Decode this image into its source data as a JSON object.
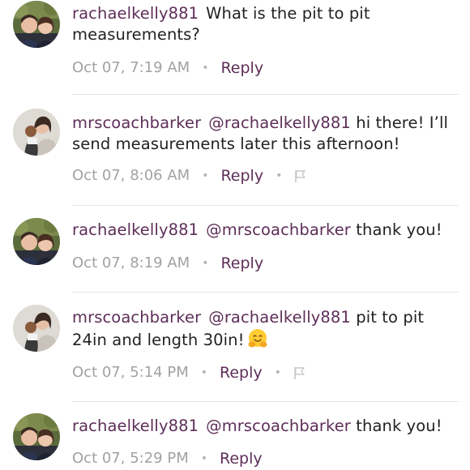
{
  "comments": [
    {
      "username": "rachaelkelly881",
      "mention": "",
      "body": "What is the pit to pit measurements?",
      "timestamp": "Oct 07, 7:19 AM",
      "reply_label": "Reply",
      "avatar_icon": "rachael-avatar",
      "has_flag": false
    },
    {
      "username": "mrscoachbarker",
      "mention": "@rachaelkelly881",
      "body": "hi there! I’ll send measurements later this afternoon!",
      "timestamp": "Oct 07, 8:06 AM",
      "reply_label": "Reply",
      "avatar_icon": "barker-avatar",
      "has_flag": true
    },
    {
      "username": "rachaelkelly881",
      "mention": "@mrscoachbarker",
      "body": "thank you!",
      "timestamp": "Oct 07, 8:19 AM",
      "reply_label": "Reply",
      "avatar_icon": "rachael-avatar",
      "has_flag": false
    },
    {
      "username": "mrscoachbarker",
      "mention": "@rachaelkelly881",
      "body": "pit to pit 24in and length 30in!",
      "emoji": "hugging-face-icon",
      "timestamp": "Oct 07, 5:14 PM",
      "reply_label": "Reply",
      "avatar_icon": "barker-avatar",
      "has_flag": true
    },
    {
      "username": "rachaelkelly881",
      "mention": "@mrscoachbarker",
      "body": "thank you!",
      "timestamp": "Oct 07, 5:29 PM",
      "reply_label": "Reply",
      "avatar_icon": "rachael-avatar",
      "has_flag": false
    }
  ],
  "separator": "•",
  "colors": {
    "accent": "#5e2e58",
    "meta_text": "#a2a2a2",
    "body_text": "#222222",
    "divider": "#e6e6e6"
  }
}
